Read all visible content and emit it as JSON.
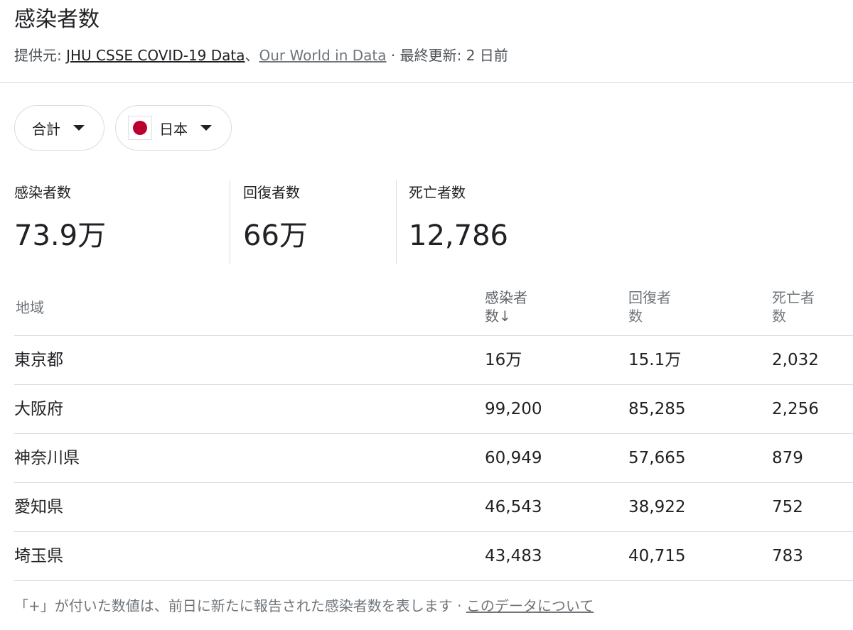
{
  "header": {
    "title": "感染者数",
    "source_prefix": "提供元: ",
    "source_link_1": "JHU CSSE COVID-19 Data",
    "source_sep": "、",
    "source_link_2": "Our World in Data",
    "updated": " · 最終更新: 2 日前"
  },
  "filters": {
    "metric": "合計",
    "country": "日本"
  },
  "summary": [
    {
      "label": "感染者数",
      "value": "73.9万"
    },
    {
      "label": "回復者数",
      "value": "66万"
    },
    {
      "label": "死亡者数",
      "value": "12,786"
    }
  ],
  "table": {
    "headers": {
      "region": "地域",
      "cases": "感染者数↓",
      "recovered": "回復者数",
      "deaths": "死亡者数"
    },
    "rows": [
      {
        "region": "東京都",
        "cases": "16万",
        "recovered": "15.1万",
        "deaths": "2,032"
      },
      {
        "region": "大阪府",
        "cases": "99,200",
        "recovered": "85,285",
        "deaths": "2,256"
      },
      {
        "region": "神奈川県",
        "cases": "60,949",
        "recovered": "57,665",
        "deaths": "879"
      },
      {
        "region": "愛知県",
        "cases": "46,543",
        "recovered": "38,922",
        "deaths": "752"
      },
      {
        "region": "埼玉県",
        "cases": "43,483",
        "recovered": "40,715",
        "deaths": "783"
      }
    ]
  },
  "footer": {
    "note": "「+」が付いた数値は、前日に新たに報告された感染者数を表します",
    "sep": " · ",
    "link": "このデータについて"
  },
  "colors": {
    "flag_red": "#bc002d",
    "divider": "#dadce0",
    "muted_text": "#70757a"
  }
}
